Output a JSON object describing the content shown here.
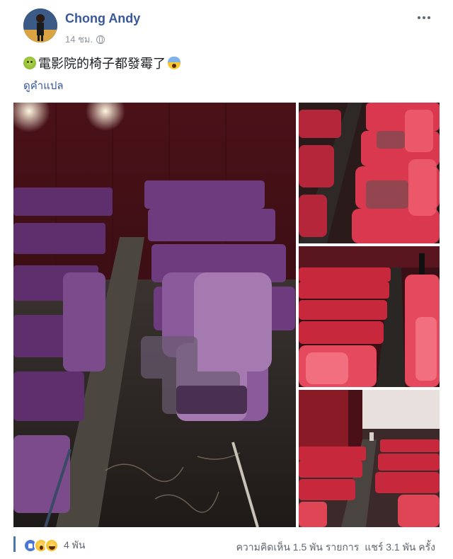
{
  "post": {
    "author": "Chong Andy",
    "timestamp": "14 ชม.",
    "text": "電影院的椅子都發霉了",
    "translate_link": "ดูคำแปล"
  },
  "footer": {
    "reaction_count": "4 พัน",
    "comments": "ความคิดเห็น 1.5 พัน รายการ",
    "shares": "แชร์ 3.1 พัน ครั้ง"
  },
  "icons": {
    "leading_emoji": "sick-face-icon",
    "trailing_emoji": "screaming-face-icon",
    "privacy": "globe-icon",
    "reactions": [
      "like-icon",
      "wow-icon",
      "haha-icon"
    ]
  },
  "colors": {
    "link": "#385898",
    "meta": "#90949c",
    "seat_red": "#c8283c",
    "seat_moldy_purple": "#6e3b7e"
  }
}
